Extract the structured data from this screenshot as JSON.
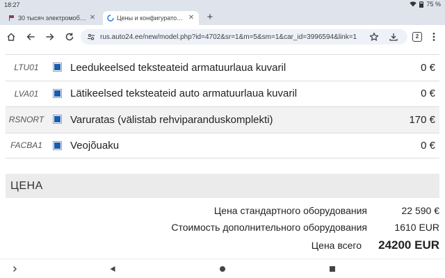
{
  "status_bar": {
    "time": "18:27",
    "battery": "75 %"
  },
  "tabs": [
    {
      "title": "30 тысяч электромобилей",
      "active": false
    },
    {
      "title": "Цены и конфигуратор - Das",
      "active": true
    }
  ],
  "toolbar": {
    "url": "rus.auto24.ee/new/model.php?id=4702&sr=1&m=5&sm=1&car_id=3996594&link=1",
    "tab_count": "2"
  },
  "options": [
    {
      "code": "LTU01",
      "name": "Leedukeelsed teksteateid armatuurlaua kuvaril",
      "price": "0 €",
      "checked": true
    },
    {
      "code": "LVA01",
      "name": "Lätikeelsed teksteateid auto armatuurlaua kuvaril",
      "price": "0 €",
      "checked": true
    },
    {
      "code": "RSNORT",
      "name": "Varuratas (välistab rehviparanduskomplekti)",
      "price": "170 €",
      "checked": true
    },
    {
      "code": "FACBA1",
      "name": "Veojõuaku",
      "price": "0 €",
      "checked": true
    }
  ],
  "price_section": {
    "title": "ЦЕНА",
    "standard_label": "Цена стандартного оборудования",
    "standard_value": "22 590 €",
    "extra_label": "Стоимость дополнительного оборудования",
    "extra_value": "1610 EUR",
    "total_label": "Цена всего",
    "total_value": "24200 EUR"
  },
  "icons": {
    "tab1_favicon": "flag-icon",
    "tab2_favicon": "loading-icon",
    "site": "site-settings-icon",
    "home": "home-icon",
    "back": "back-arrow-icon",
    "forward": "forward-arrow-icon",
    "reload": "reload-icon",
    "bookmark": "star-icon",
    "download": "download-icon",
    "menu": "more-vert-icon"
  },
  "colors": {
    "checkbox_fill": "#1a5cb0",
    "chrome_bg": "#dfe3ec",
    "omnibox_bg": "#eef1f7"
  }
}
